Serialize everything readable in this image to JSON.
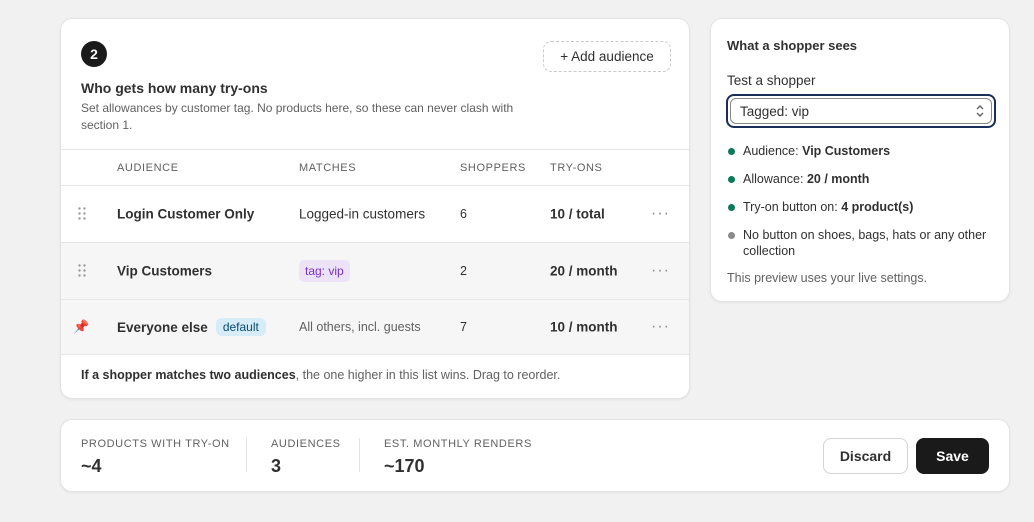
{
  "section": {
    "step": "2",
    "title": "Who gets how many try-ons",
    "description": "Set allowances by customer tag. No products here, so these can never clash with section 1.",
    "add_label": "+ Add audience"
  },
  "table": {
    "headers": {
      "audience": "AUDIENCE",
      "matches": "MATCHES",
      "shoppers": "SHOPPERS",
      "tryons": "TRY-ONS"
    },
    "rows": [
      {
        "name": "Login Customer Only",
        "matches": "Logged-in customers",
        "shoppers": "6",
        "tryons": "10 / total"
      },
      {
        "name": "Vip Customers",
        "matches": "tag: vip",
        "shoppers": "2",
        "tryons": "20 / month"
      },
      {
        "name": "Everyone else",
        "badge": "default",
        "matches": "All others, incl. guests",
        "shoppers": "7",
        "tryons": "10 / month"
      }
    ],
    "more_glyph": "···",
    "pin_glyph": "📌",
    "footnote_bold": "If a shopper matches two audiences",
    "footnote_rest": ", the one higher in this list wins. Drag to reorder."
  },
  "preview": {
    "title": "What a shopper sees",
    "test_label": "Test a shopper",
    "selected": "Tagged: vip",
    "items": [
      {
        "prefix": "Audience: ",
        "value": "Vip Customers",
        "color": "#0a7a5a"
      },
      {
        "prefix": "Allowance: ",
        "value": "20 / month",
        "color": "#0a7a5a"
      },
      {
        "prefix": "Try-on button on: ",
        "value": "4 product(s)",
        "color": "#0a7a5a"
      },
      {
        "prefix": "No button on shoes, bags, hats or any other collection",
        "value": "",
        "color": "#8a8a8a"
      }
    ],
    "note": "This preview uses your live settings."
  },
  "stats": [
    {
      "label": "PRODUCTS WITH TRY-ON",
      "value": "~4"
    },
    {
      "label": "AUDIENCES",
      "value": "3"
    },
    {
      "label": "EST. MONTHLY RENDERS",
      "value": "~170"
    }
  ],
  "actions": {
    "discard": "Discard",
    "save": "Save"
  },
  "colors": {
    "accent_dark": "#1a1a1a",
    "positive": "#0a7a5a",
    "tag_purple": "#7a2fc4",
    "default_blue": "#d6ecf8"
  },
  "icons": {
    "grip": "drag-handle-icon",
    "pin": "pin-icon",
    "more": "more-horizontal-icon",
    "select": "chevron-up-down-icon"
  }
}
